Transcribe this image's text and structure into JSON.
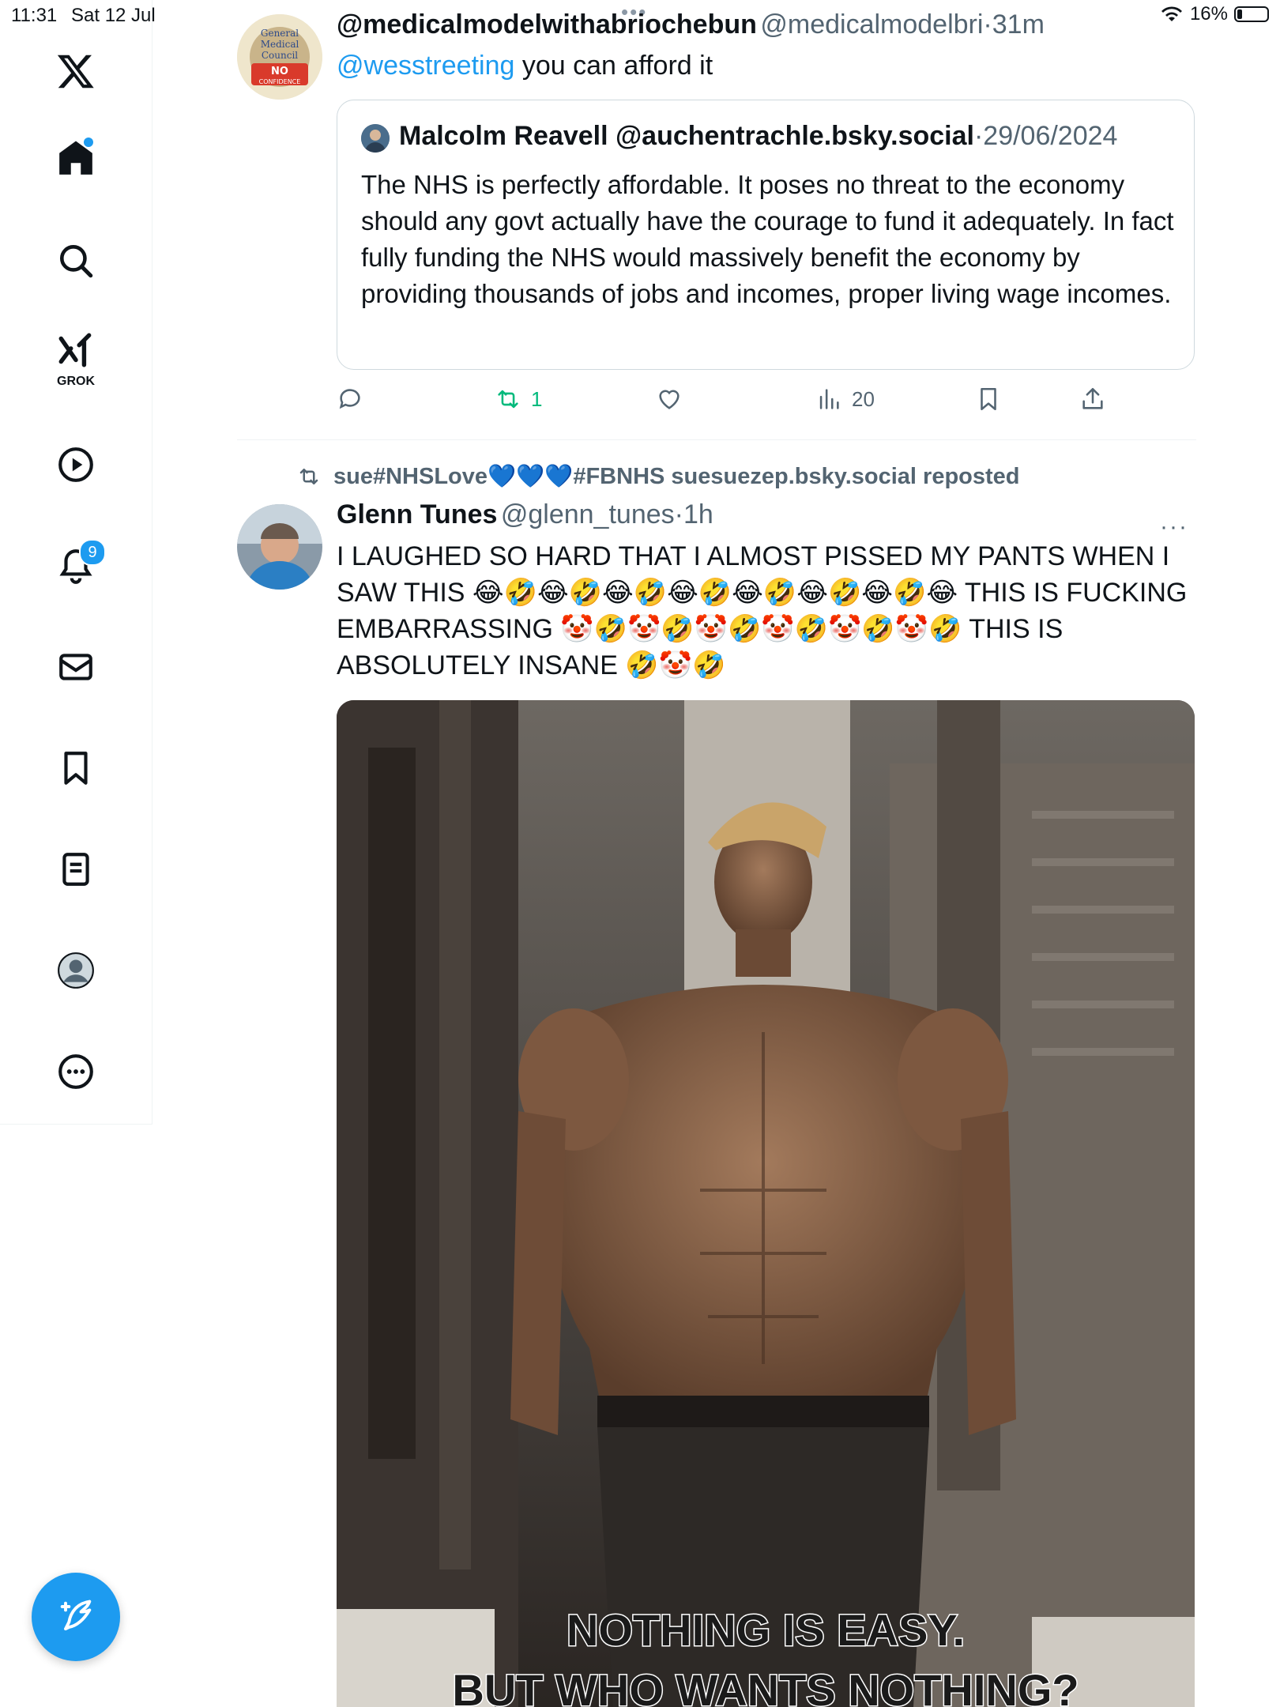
{
  "status_bar": {
    "time": "11:31",
    "date": "Sat 12 Jul",
    "battery": "16%",
    "battery_level": 0.16
  },
  "nav": {
    "notifications_badge": "9",
    "grok_label": "GROK"
  },
  "tweet1": {
    "author_name": "@medicalmodelwithabriochebun",
    "author_handle": "@medicalmodelbri",
    "sep": "·",
    "time": "31m",
    "mention": "@wesstreeting",
    "text": "you can afford it",
    "avatar_text": [
      "General",
      "Medical",
      "Council",
      "NO",
      "CONFIDENCE"
    ],
    "quote": {
      "author_name": "Malcolm Reavell",
      "author_handle": "@auchentrachle.bsky.social",
      "sep": "·",
      "date": "29/06/2024",
      "text": "The NHS is perfectly affordable. It poses no threat to the economy should any govt actually have the courage to fund it adequately. In fact fully funding the NHS would massively benefit the economy by providing  thousands of jobs and incomes, proper living wage incomes."
    },
    "actions": {
      "reposts": "1",
      "views": "20"
    }
  },
  "tweet2": {
    "repost_text": "sue#NHSLove💙💙💙#FBNHS suesuezep.bsky.social reposted",
    "author_name": "Glenn Tunes",
    "author_handle": "@glenn_tunes",
    "sep": "·",
    "time": "1h",
    "more": "···",
    "text": "I LAUGHED SO HARD THAT  I ALMOST PISSED MY PANTS WHEN I SAW THIS 😂🤣😂🤣😂🤣😂🤣😂🤣😂🤣😂🤣😂 THIS IS FUCKING EMBARRASSING 🤡🤣🤡🤣🤡🤣🤡🤣🤡🤣🤡🤣 THIS IS ABSOLUTELY INSANE 🤣🤡🤣",
    "image_caption_1": "NOTHING IS EASY.",
    "image_caption_2": "BUT WHO WANTS NOTHING?"
  },
  "colors": {
    "accent": "#1d9bf0",
    "repost_green": "#00ba7c",
    "muted": "#536471"
  },
  "icons": [
    "x-logo-icon",
    "home-icon",
    "search-icon",
    "grok-icon",
    "video-icon",
    "bell-icon",
    "mail-icon",
    "bookmark-icon",
    "list-icon",
    "profile-icon",
    "more-icon",
    "compose-icon",
    "reply-icon",
    "repost-icon",
    "like-icon",
    "views-icon",
    "bookmark-icon",
    "share-icon"
  ]
}
